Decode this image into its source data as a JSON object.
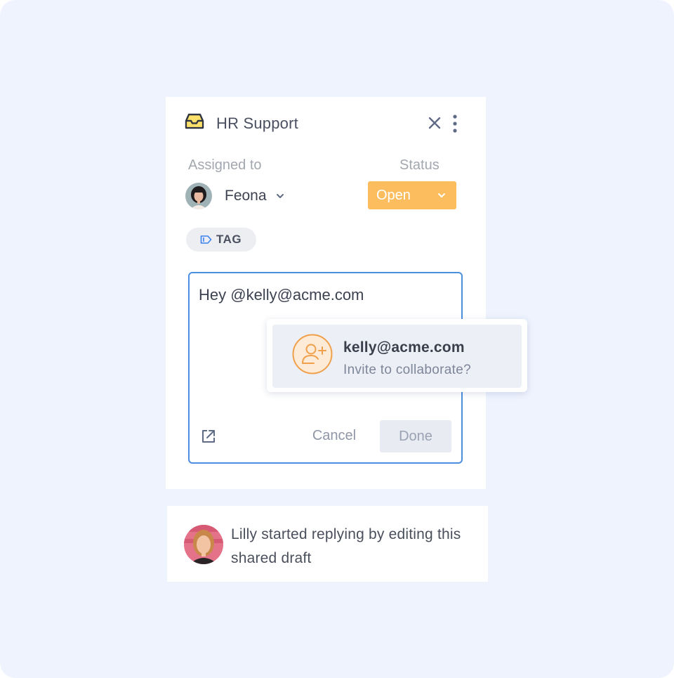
{
  "panel": {
    "title": "HR Support",
    "icons": {
      "inbox": "inbox-tray-icon",
      "close": "close-icon",
      "more": "more-vertical-icon"
    }
  },
  "assignment": {
    "assigned_label": "Assigned to",
    "assignee_name": "Feona",
    "status_label": "Status",
    "status_value": "Open"
  },
  "tag": {
    "label": "TAG"
  },
  "editor": {
    "text": "Hey @kelly@acme.com",
    "cancel_label": "Cancel",
    "done_label": "Done"
  },
  "invite": {
    "email": "kelly@acme.com",
    "prompt": "Invite to collaborate?"
  },
  "activity": {
    "message": "Lilly started replying by editing this shared draft"
  },
  "colors": {
    "background": "#eef3fe",
    "status_open": "#fbbd5e",
    "editor_border": "#4a8fe0",
    "invite_accent": "#f0a04b"
  }
}
